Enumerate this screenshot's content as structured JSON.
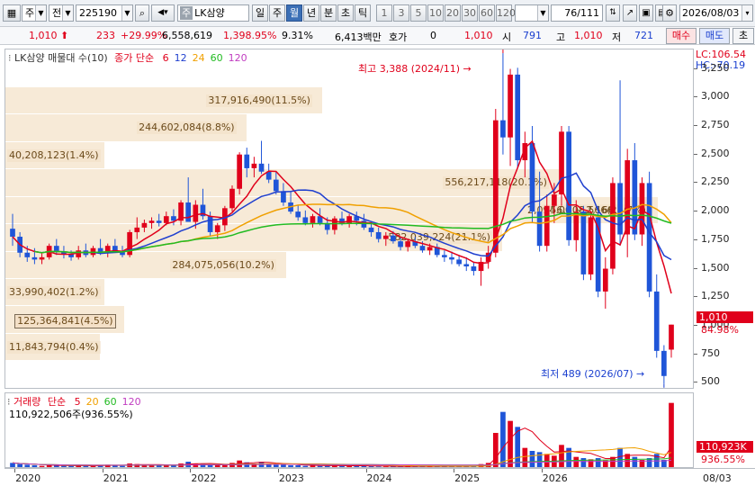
{
  "toolbar": {
    "market_label": "주",
    "mode_label": "전",
    "code_value": "225190",
    "stock_badge": "주",
    "stock_name": "LK삼양",
    "periods": [
      "일",
      "주",
      "월",
      "년",
      "분",
      "초",
      "틱"
    ],
    "active_period": "월",
    "intervals": [
      "1",
      "3",
      "5",
      "10",
      "20",
      "30",
      "60",
      "120"
    ],
    "page_counter": "76/111",
    "date_value": "2026/08/03"
  },
  "quote": {
    "price": "1,010",
    "change": "233",
    "change_pct": "+29.99%",
    "volume": "6,558,619",
    "volume_pct": "1,398.95%",
    "turnover": "9.31%",
    "amount": "6,413백만",
    "hoga_label": "호가",
    "hoga_value": "0",
    "bid_price": "1,010",
    "open_label": "시",
    "open_value": "791",
    "high_label": "고",
    "high_value": "1,010",
    "low_label": "저",
    "low_value": "721",
    "buy_label": "매수",
    "sell_label": "매도",
    "end_label": "초"
  },
  "price_pane": {
    "title": "LK삼양 매물대 수(10)",
    "ma_label": "종가 단순",
    "ma_periods": [
      "6",
      "12",
      "24",
      "60",
      "120"
    ],
    "ma_colors": [
      "#e0001b",
      "#1f3fcf",
      "#f0a000",
      "#22bb22",
      "#c03cc0"
    ],
    "high_annotation": "최고 3,388 (2024/11)",
    "low_annotation": "최저 489 (2026/07)",
    "lc_label": "LC:106.54",
    "hc_label": "HC:-70.19",
    "current_price_tag": "1,010",
    "current_pct_tag": "84.98%",
    "volume_profile": [
      {
        "label": "317,916,490(11.5%)",
        "price_top": 3090,
        "price_bottom": 2850
      },
      {
        "label": "244,602,084(8.8%)",
        "price_top": 2855,
        "price_bottom": 2610
      },
      {
        "label": "40,208,123(1.4%)",
        "price_top": 2610,
        "price_bottom": 2370
      },
      {
        "label": "556,217,118(20.1%)",
        "price_top": 2370,
        "price_bottom": 2130
      },
      {
        "label": "656,808,566(23.7%)",
        "price_top": 2130,
        "price_bottom": 1890
      },
      {
        "label": "582,039,224(21.1%)",
        "price_top": 1890,
        "price_bottom": 1650
      },
      {
        "label": "284,075,056(10.2%)",
        "price_top": 1650,
        "price_bottom": 1410
      },
      {
        "label": "33,990,402(1.2%)",
        "price_top": 1410,
        "price_bottom": 1170
      },
      {
        "label": "125,364,841(4.5%)",
        "price_top": 1170,
        "price_bottom": 930
      },
      {
        "label": "11,843,794(0.4%)",
        "price_top": 930,
        "price_bottom": 690
      }
    ],
    "overlay_label": "2,094.00 ~ 2,166.50",
    "y_ticks": [
      "3,250",
      "3,000",
      "2,750",
      "2,500",
      "2,250",
      "2,000",
      "1,750",
      "1,500",
      "1,250",
      "1,000",
      "750",
      "500"
    ]
  },
  "volume_pane": {
    "title": "거래량",
    "ma_label": "단순",
    "ma_periods": [
      "5",
      "20",
      "60",
      "120"
    ],
    "ma_colors": [
      "#e0001b",
      "#f0a000",
      "#22bb22",
      "#c03cc0"
    ],
    "last_volume": "110,922,506주(936.55%)",
    "vol_tag": "110,923K",
    "vol_pct_tag": "936.55%",
    "y_ticks": [
      "300,000K",
      "200,000K",
      "100,000K"
    ]
  },
  "time_axis": {
    "labels": [
      "2020",
      "2021",
      "2022",
      "2023",
      "2024",
      "2025",
      "2026"
    ],
    "end_label": "08/03"
  },
  "chart_data": {
    "type": "candlestick",
    "period": "monthly",
    "ylim": [
      440,
      3420
    ],
    "candles": [
      [
        1850,
        1980,
        1700,
        1780,
        10
      ],
      [
        1780,
        1820,
        1600,
        1640,
        8
      ],
      [
        1640,
        1700,
        1560,
        1600,
        7
      ],
      [
        1600,
        1680,
        1540,
        1580,
        6
      ],
      [
        1580,
        1640,
        1540,
        1600,
        5
      ],
      [
        1600,
        1720,
        1580,
        1700,
        6
      ],
      [
        1700,
        1760,
        1620,
        1650,
        6
      ],
      [
        1650,
        1700,
        1590,
        1630,
        5
      ],
      [
        1630,
        1660,
        1570,
        1600,
        5
      ],
      [
        1600,
        1700,
        1580,
        1660,
        6
      ],
      [
        1660,
        1720,
        1600,
        1620,
        5
      ],
      [
        1620,
        1700,
        1600,
        1680,
        5
      ],
      [
        1680,
        1760,
        1620,
        1640,
        6
      ],
      [
        1640,
        1720,
        1600,
        1700,
        7
      ],
      [
        1700,
        1760,
        1640,
        1650,
        6
      ],
      [
        1650,
        1700,
        1600,
        1620,
        5
      ],
      [
        1620,
        1840,
        1600,
        1820,
        9
      ],
      [
        1820,
        1950,
        1760,
        1860,
        8
      ],
      [
        1860,
        1930,
        1820,
        1900,
        7
      ],
      [
        1900,
        1950,
        1850,
        1920,
        6
      ],
      [
        1920,
        1980,
        1870,
        1900,
        6
      ],
      [
        1900,
        2000,
        1880,
        1960,
        7
      ],
      [
        1960,
        2020,
        1880,
        1920,
        6
      ],
      [
        1920,
        2100,
        1880,
        2080,
        9
      ],
      [
        2080,
        2300,
        1960,
        1910,
        12
      ],
      [
        1910,
        2100,
        1850,
        2060,
        9
      ],
      [
        2060,
        2200,
        1930,
        1960,
        8
      ],
      [
        1960,
        2000,
        1780,
        1820,
        7
      ],
      [
        1820,
        1900,
        1760,
        1880,
        6
      ],
      [
        1880,
        2050,
        1830,
        2030,
        8
      ],
      [
        2030,
        2230,
        2000,
        2200,
        10
      ],
      [
        2200,
        2520,
        2150,
        2500,
        14
      ],
      [
        2500,
        2560,
        2300,
        2380,
        11
      ],
      [
        2380,
        2480,
        2300,
        2420,
        9
      ],
      [
        2420,
        2620,
        2330,
        2350,
        12
      ],
      [
        2350,
        2420,
        2250,
        2280,
        9
      ],
      [
        2280,
        2350,
        2150,
        2180,
        8
      ],
      [
        2180,
        2250,
        2050,
        2080,
        7
      ],
      [
        2080,
        2180,
        1980,
        2000,
        6
      ],
      [
        2000,
        2060,
        1920,
        1950,
        6
      ],
      [
        1950,
        2010,
        1880,
        1900,
        5
      ],
      [
        1900,
        1980,
        1860,
        1960,
        6
      ],
      [
        1960,
        2030,
        1880,
        1900,
        5
      ],
      [
        1900,
        1950,
        1800,
        1840,
        5
      ],
      [
        1840,
        1960,
        1800,
        1940,
        6
      ],
      [
        1940,
        2000,
        1880,
        1900,
        5
      ],
      [
        1900,
        1980,
        1860,
        1960,
        5
      ],
      [
        1960,
        2000,
        1880,
        1920,
        5
      ],
      [
        1920,
        1980,
        1840,
        1860,
        5
      ],
      [
        1860,
        1900,
        1780,
        1820,
        5
      ],
      [
        1820,
        1860,
        1730,
        1760,
        4
      ],
      [
        1760,
        1820,
        1700,
        1790,
        4
      ],
      [
        1790,
        1830,
        1720,
        1740,
        4
      ],
      [
        1740,
        1780,
        1660,
        1690,
        4
      ],
      [
        1690,
        1760,
        1650,
        1740,
        4
      ],
      [
        1740,
        1780,
        1680,
        1700,
        4
      ],
      [
        1700,
        1740,
        1640,
        1660,
        4
      ],
      [
        1660,
        1720,
        1620,
        1690,
        4
      ],
      [
        1690,
        1720,
        1600,
        1620,
        4
      ],
      [
        1620,
        1660,
        1560,
        1600,
        4
      ],
      [
        1600,
        1650,
        1540,
        1580,
        4
      ],
      [
        1580,
        1620,
        1520,
        1540,
        4
      ],
      [
        1540,
        1600,
        1480,
        1520,
        5
      ],
      [
        1520,
        1560,
        1440,
        1480,
        5
      ],
      [
        1480,
        1600,
        1350,
        1560,
        8
      ],
      [
        1560,
        1700,
        1500,
        1640,
        10
      ],
      [
        1640,
        2900,
        1600,
        2800,
        60
      ],
      [
        2800,
        3388,
        2500,
        2650,
        95
      ],
      [
        2650,
        3250,
        2400,
        3200,
        80
      ],
      [
        3200,
        3260,
        2380,
        2450,
        70
      ],
      [
        2450,
        2700,
        2300,
        2600,
        35
      ],
      [
        2600,
        2750,
        1900,
        2000,
        30
      ],
      [
        2000,
        2350,
        1650,
        1700,
        28
      ],
      [
        1700,
        2150,
        1650,
        2050,
        25
      ],
      [
        2050,
        2250,
        1900,
        2150,
        22
      ],
      [
        2150,
        2750,
        2050,
        2700,
        40
      ],
      [
        2700,
        2750,
        1700,
        1750,
        35
      ],
      [
        1750,
        2100,
        1650,
        2000,
        20
      ],
      [
        2000,
        2050,
        1400,
        1450,
        18
      ],
      [
        1450,
        2000,
        1400,
        1950,
        16
      ],
      [
        1950,
        2050,
        1250,
        1300,
        18
      ],
      [
        1300,
        1600,
        1150,
        1500,
        14
      ],
      [
        1500,
        2300,
        1450,
        2250,
        20
      ],
      [
        2250,
        3150,
        1700,
        1800,
        35
      ],
      [
        1800,
        2550,
        1600,
        2450,
        25
      ],
      [
        2450,
        2600,
        1750,
        1800,
        20
      ],
      [
        1800,
        2300,
        1700,
        2250,
        15
      ],
      [
        2250,
        2350,
        1250,
        1300,
        18
      ],
      [
        1300,
        1450,
        720,
        780,
        25
      ],
      [
        780,
        830,
        489,
        560,
        15
      ],
      [
        791,
        1010,
        721,
        1010,
        110
      ]
    ],
    "y_label_unit": "KRW"
  }
}
